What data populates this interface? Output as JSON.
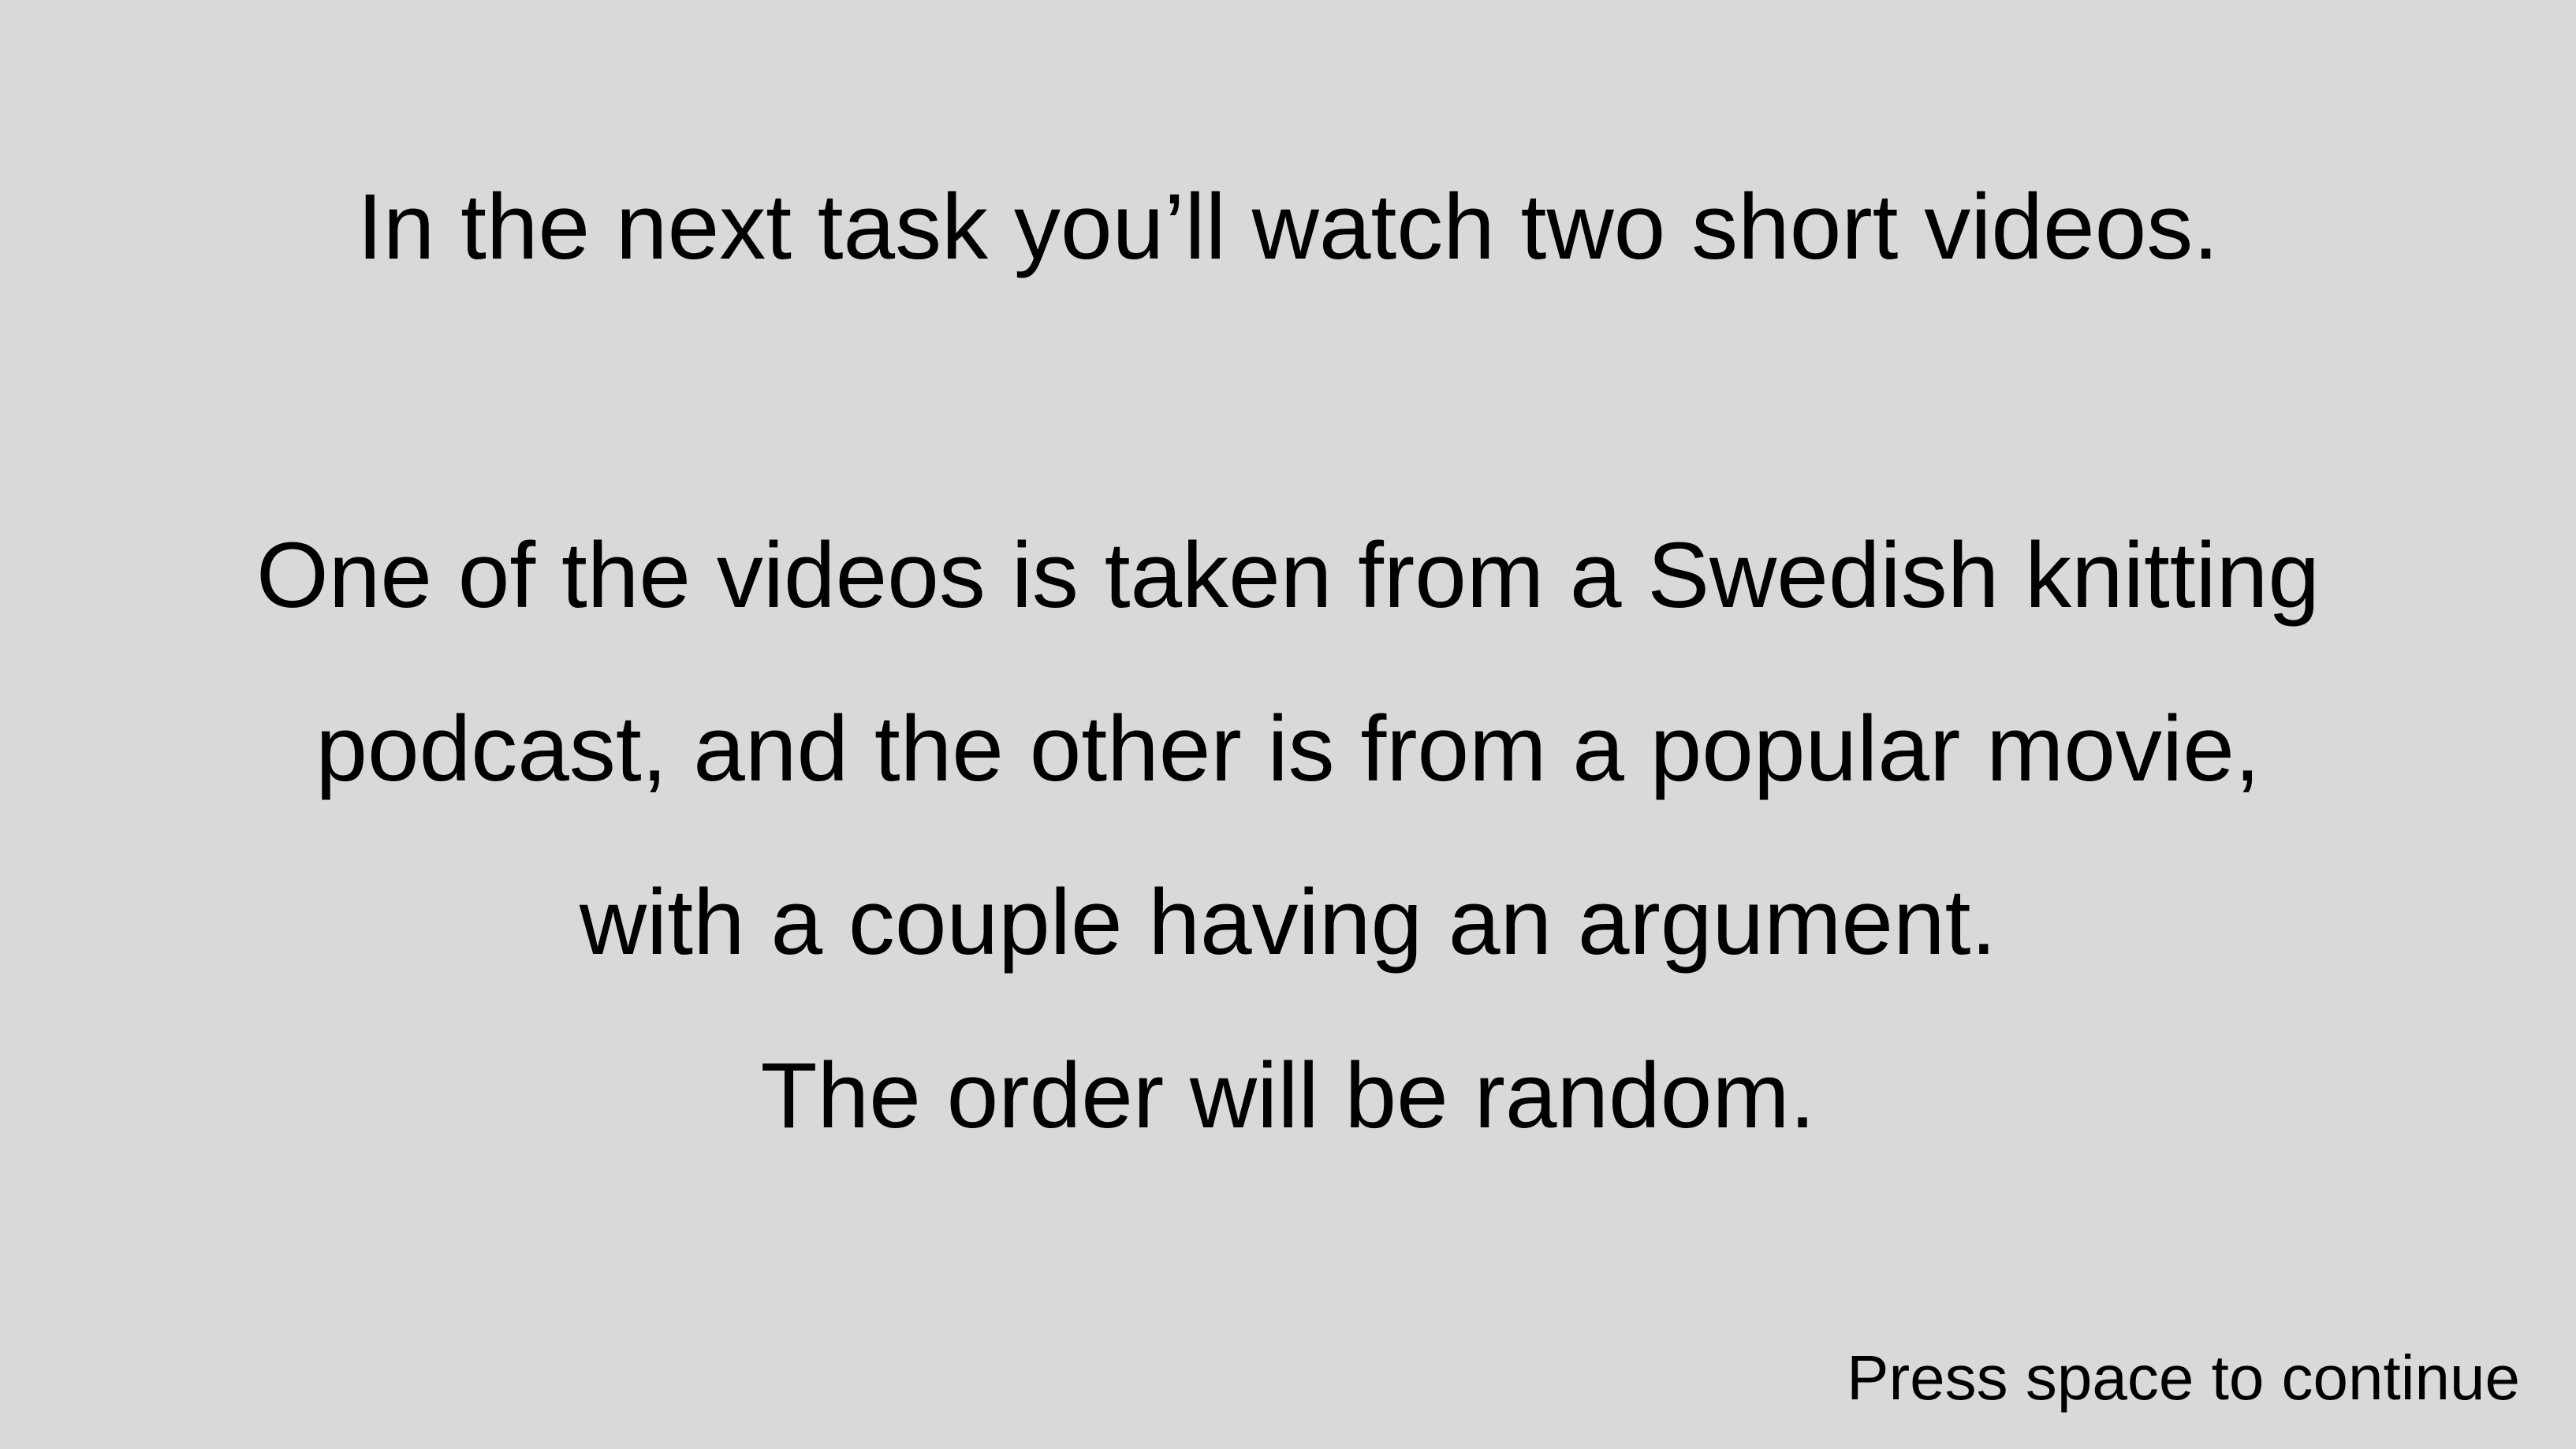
{
  "instructions": {
    "intro": "In the next task you’ll watch two short videos.",
    "body_lines": [
      "One of the videos is taken from a Swedish knitting",
      "podcast, and the other is from a popular movie,",
      "with a couple having an argument.",
      "The order will be random."
    ]
  },
  "footer": {
    "continue_prompt": "Press space to continue"
  }
}
